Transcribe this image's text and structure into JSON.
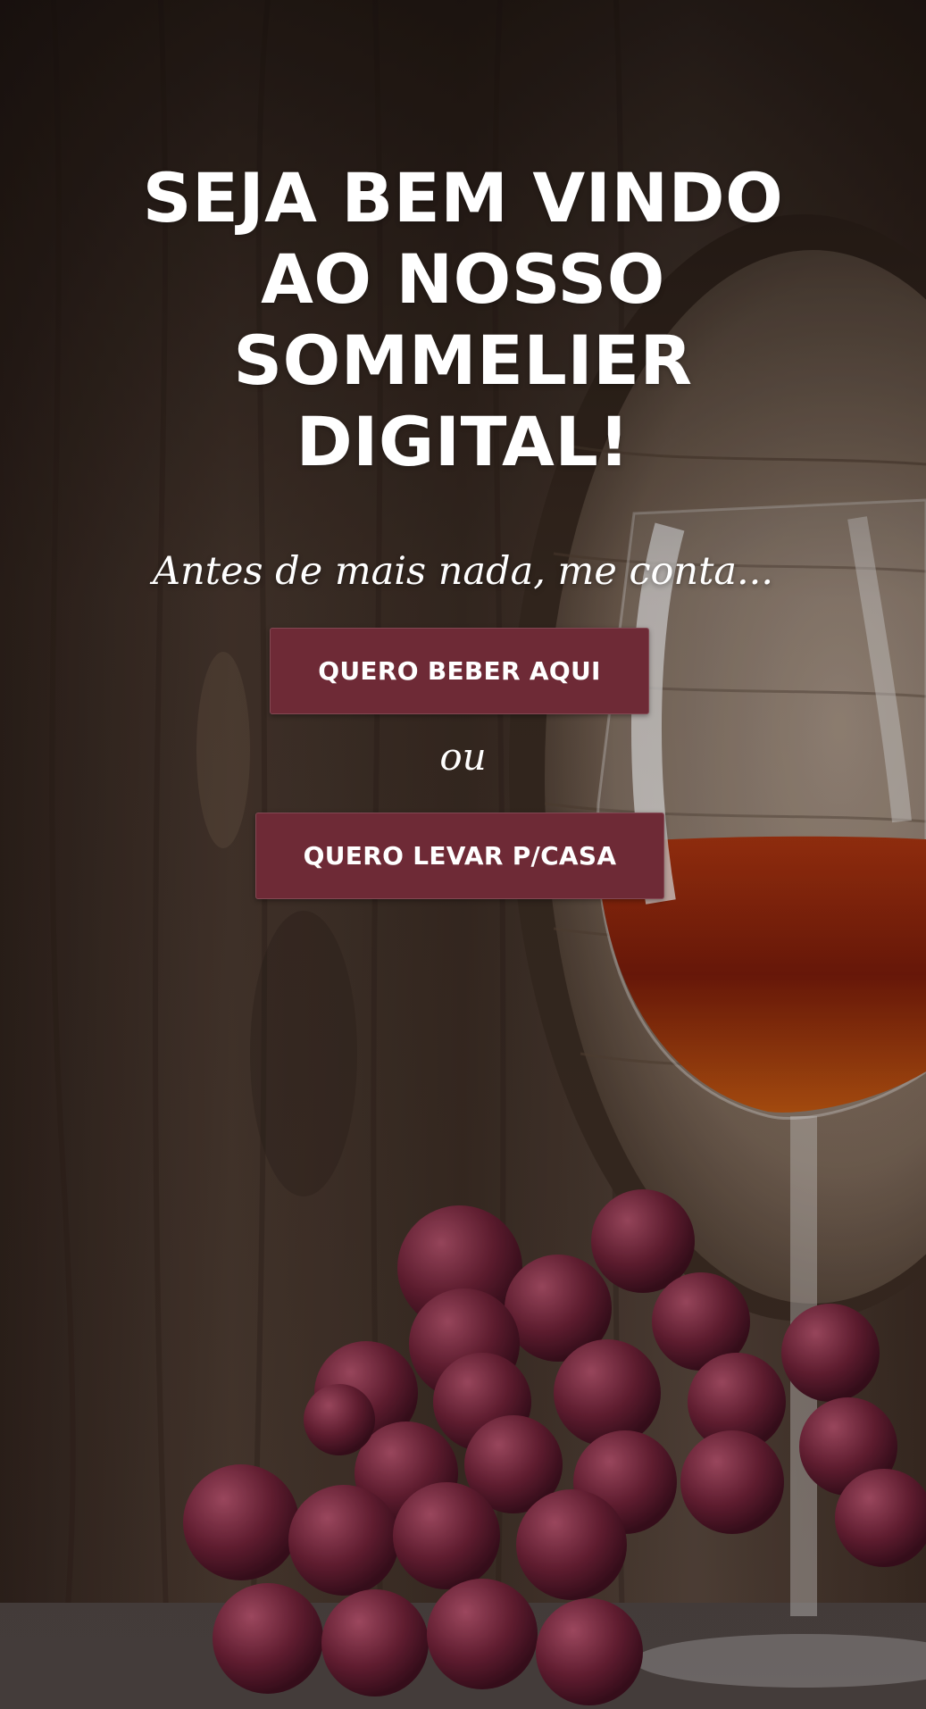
{
  "hero": {
    "title_lines": [
      "SEJA BEM VINDO",
      "AO NOSSO",
      "SOMMELIER",
      "DIGITAL!"
    ],
    "subtitle": "Antes de mais nada, me conta...",
    "button_primary_label": "QUERO BEBER AQUI",
    "separator": "ou",
    "button_secondary_label": "QUERO LEVAR P/CASA"
  },
  "colors": {
    "button_bg": "#6e2a36",
    "text": "#ffffff",
    "wood_dark": "#3a2a20",
    "wine": "#8a1f0e",
    "grape": "#6b1f35"
  },
  "background": {
    "description_icons": [
      "wood-panel-background",
      "wine-barrel-image",
      "wine-glass-image",
      "grapes-image"
    ]
  }
}
